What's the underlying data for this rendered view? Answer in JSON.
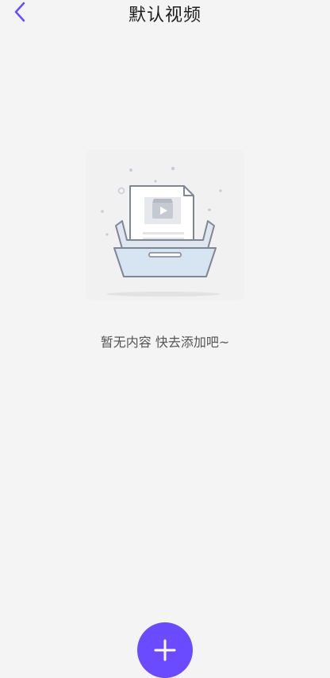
{
  "header": {
    "title": "默认视频",
    "back_icon": "chevron-left-icon"
  },
  "empty_state": {
    "illustration": "empty-inbox-document-video-illustration",
    "message": "暂无内容 快去添加吧~"
  },
  "fab": {
    "icon": "plus-icon",
    "color": "#6a4bff"
  },
  "colors": {
    "accent": "#6a4bff",
    "background": "#f4f4f4"
  }
}
